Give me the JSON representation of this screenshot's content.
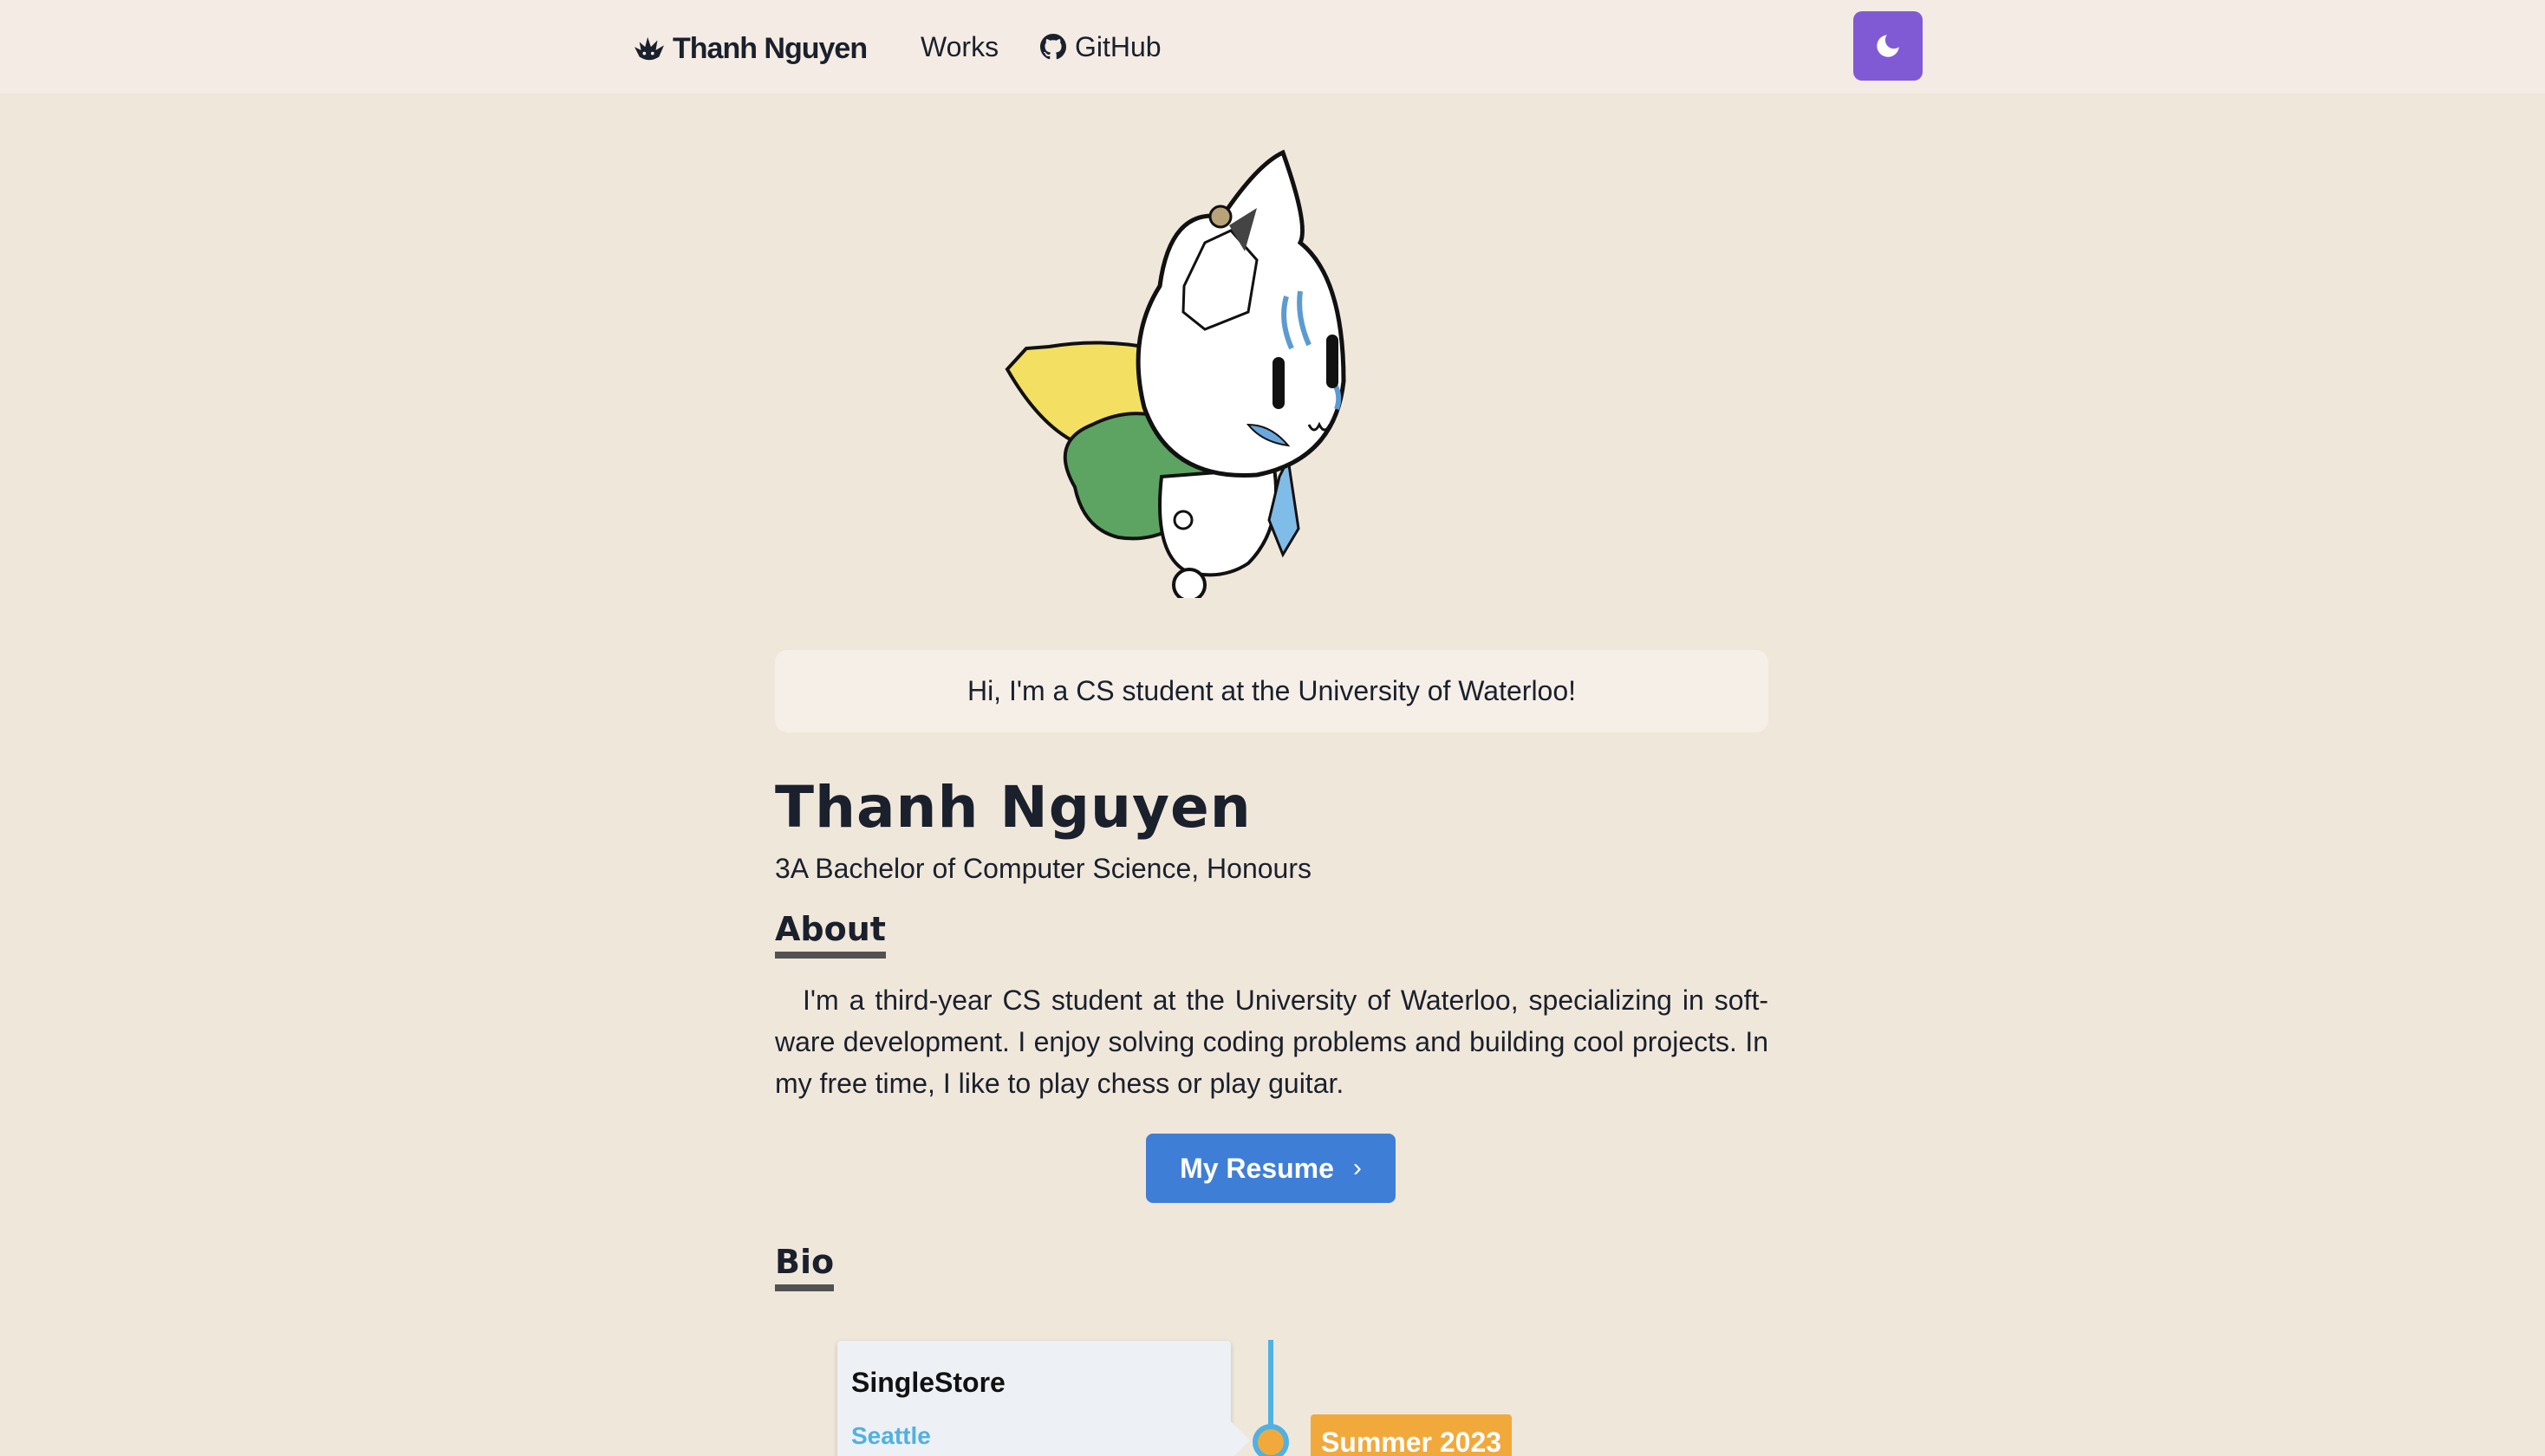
{
  "nav": {
    "logo_text": "Thanh Nguyen",
    "logo_icon": "paw-icon",
    "links": [
      {
        "label": "Works"
      },
      {
        "label": "GitHub",
        "icon": "github-icon"
      }
    ],
    "theme_toggle_icon": "moon-icon"
  },
  "hero": {
    "greeting": "Hi, I'm a CS student at the University of Waterloo!",
    "name": "Thanh Nguyen",
    "degree": "3A Bachelor of Computer Science, Honours"
  },
  "about": {
    "heading": "About",
    "text": "I'm a third-year CS student at the University of Waterloo, specializing in soft­ware development. I enjoy solving coding problems and building cool projects. In my free time, I like to play chess or play guitar.",
    "resume_label": "My Resume",
    "resume_icon": "chevron-right-icon"
  },
  "bio": {
    "heading": "Bio",
    "entries": [
      {
        "company": "SingleStore",
        "location": "Seattle",
        "date": "Summer 2023"
      }
    ]
  },
  "colors": {
    "page_bg": "#f0e7db",
    "navbar_bg": "#f4ece4",
    "theme_button": "#805ad5",
    "resume_button": "#3f7ed6",
    "timeline_line": "#4fb1e4",
    "timeline_date": "#f2a93b"
  }
}
